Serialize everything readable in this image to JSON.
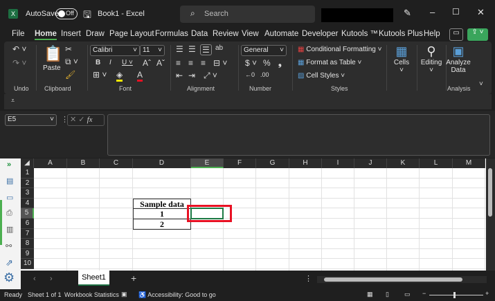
{
  "titlebar": {
    "autosave_label": "AutoSave",
    "autosave_state": "Off",
    "doc_title": "Book1  -  Excel",
    "search_placeholder": "Search"
  },
  "tabs": [
    "File",
    "Home",
    "Insert",
    "Draw",
    "Page Layout",
    "Formulas",
    "Data",
    "Review",
    "View",
    "Automate",
    "Developer",
    "Kutools ™",
    "Kutools Plus",
    "Help"
  ],
  "active_tab": "Home",
  "ribbon": {
    "groups": {
      "undo": "Undo",
      "clipboard": "Clipboard",
      "font": "Font",
      "alignment": "Alignment",
      "number": "Number",
      "styles": "Styles",
      "analysis": "Analysis"
    },
    "paste": "Paste",
    "font_name": "Calibri",
    "font_size": "11",
    "number_format": "General",
    "conditional_formatting": "Conditional Formatting",
    "format_as_table": "Format as Table",
    "cell_styles": "Cell Styles",
    "cells": "Cells",
    "editing": "Editing",
    "analyze_data": "Analyze Data"
  },
  "formula_bar": {
    "name_box": "E5",
    "formula": ""
  },
  "columns": [
    "A",
    "B",
    "C",
    "D",
    "E",
    "F",
    "G",
    "H",
    "I",
    "J",
    "K",
    "L",
    "M"
  ],
  "rows": [
    "1",
    "2",
    "3",
    "4",
    "5",
    "6",
    "7",
    "8",
    "9",
    "10"
  ],
  "cells": {
    "D4": "Sample data",
    "D5": "1",
    "D6": "2"
  },
  "selected_cell": "E5",
  "highlight_color": "#e81123",
  "sheet_tabs": [
    "Sheet1"
  ],
  "status": {
    "ready": "Ready",
    "sheet_count": "Sheet 1 of 1",
    "workbook_stats": "Workbook Statistics",
    "accessibility": "Accessibility: Good to go"
  }
}
